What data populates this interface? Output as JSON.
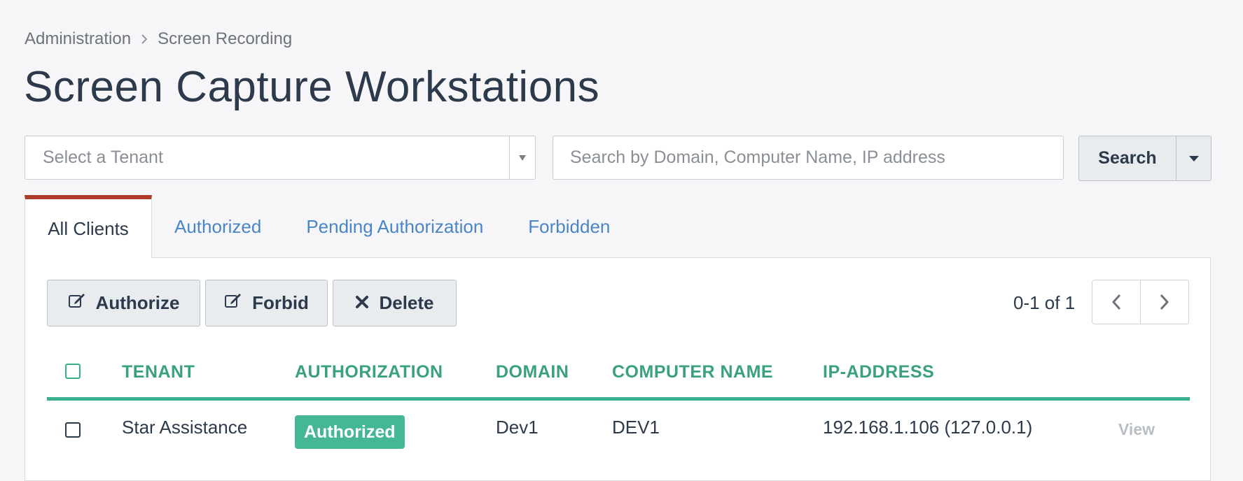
{
  "breadcrumb": {
    "items": [
      "Administration",
      "Screen Recording"
    ]
  },
  "page_title": "Screen Capture Workstations",
  "filters": {
    "tenant_placeholder": "Select a Tenant",
    "search_placeholder": "Search by Domain, Computer Name, IP address",
    "search_label": "Search"
  },
  "tabs": [
    {
      "label": "All Clients",
      "active": true
    },
    {
      "label": "Authorized",
      "active": false
    },
    {
      "label": "Pending Authorization",
      "active": false
    },
    {
      "label": "Forbidden",
      "active": false
    }
  ],
  "actions": {
    "authorize_label": "Authorize",
    "forbid_label": "Forbid",
    "delete_label": "Delete"
  },
  "pagination": {
    "range_text": "0-1 of 1"
  },
  "table": {
    "columns": [
      "TENANT",
      "AUTHORIZATION",
      "DOMAIN",
      "COMPUTER NAME",
      "IP-ADDRESS"
    ],
    "rows": [
      {
        "tenant": "Star Assistance",
        "authorization": "Authorized",
        "domain": "Dev1",
        "computer_name": "DEV1",
        "ip_address": "192.168.1.106 (127.0.0.1)",
        "action": "View"
      }
    ]
  },
  "colors": {
    "accent_green": "#3bb08f",
    "active_tab_border": "#b23a2b",
    "link_blue": "#4a86c5",
    "title_text": "#2c3a4b"
  },
  "icons": {
    "breadcrumb_separator": "chevron-right-icon",
    "tenant_dropdown": "triangle-down-icon",
    "search_dropdown": "caret-down-icon",
    "authorize": "edit-icon",
    "forbid": "edit-icon",
    "delete": "close-icon",
    "prev": "chevron-left-icon",
    "next": "chevron-right-icon"
  }
}
